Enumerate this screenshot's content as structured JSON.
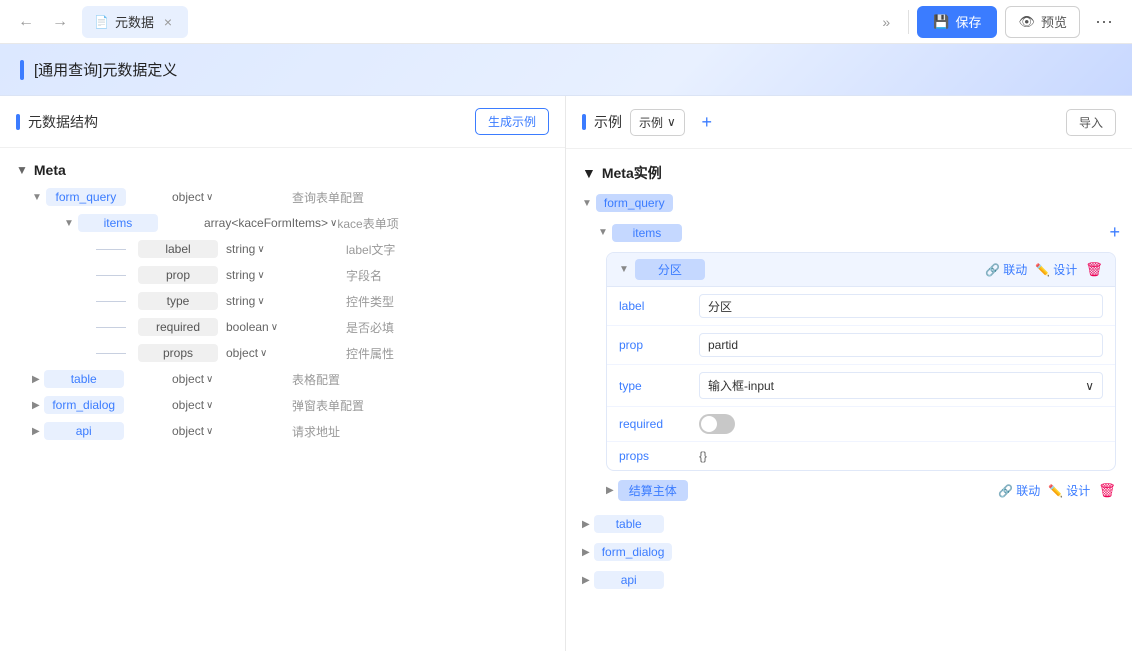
{
  "topbar": {
    "undo_label": "↩",
    "redo_label": "↪",
    "tab_label": "元数据",
    "tab_icon": "📄",
    "expand_icon": "»",
    "save_label": "保存",
    "save_icon": "💾",
    "preview_label": "预览",
    "preview_icon": "👁",
    "more_icon": "•••"
  },
  "page_title": "[通用查询]元数据定义",
  "left_panel": {
    "title": "元数据结构",
    "gen_btn": "生成示例",
    "section": "Meta",
    "items": [
      {
        "key": "form_query",
        "type": "object",
        "desc": "查询表单配置",
        "level": 1,
        "expanded": true,
        "children": [
          {
            "key": "items",
            "type": "array<kaceFormItems>",
            "desc": "kace表单项",
            "level": 2,
            "expanded": true,
            "children": [
              {
                "key": "label",
                "type": "string",
                "desc": "label文字",
                "level": 3
              },
              {
                "key": "prop",
                "type": "string",
                "desc": "字段名",
                "level": 3
              },
              {
                "key": "type",
                "type": "string",
                "desc": "控件类型",
                "level": 3
              },
              {
                "key": "required",
                "type": "boolean",
                "desc": "是否必填",
                "level": 3
              },
              {
                "key": "props",
                "type": "object",
                "desc": "控件属性",
                "level": 3
              }
            ]
          }
        ]
      },
      {
        "key": "table",
        "type": "object",
        "desc": "表格配置",
        "level": 1,
        "expanded": false
      },
      {
        "key": "form_dialog",
        "type": "object",
        "desc": "弹窗表单配置",
        "level": 1,
        "expanded": false
      },
      {
        "key": "api",
        "type": "object",
        "desc": "请求地址",
        "level": 1,
        "expanded": false
      }
    ]
  },
  "right_panel": {
    "title": "示例",
    "section": "Meta实例",
    "example_label": "示例",
    "import_label": "导入",
    "add_icon": "+",
    "items": [
      {
        "key": "form_query",
        "level": 1,
        "expanded": true,
        "selected": true
      },
      {
        "key": "items",
        "level": 2,
        "expanded": true,
        "selected": true,
        "children": [
          {
            "key": "分区",
            "level": 3,
            "expanded": true,
            "selected": true,
            "fields": [
              {
                "label": "label",
                "value": "分区",
                "type": "input"
              },
              {
                "label": "prop",
                "value": "partid",
                "type": "input"
              },
              {
                "label": "type",
                "value": "输入框-input",
                "type": "select"
              },
              {
                "label": "required",
                "value": "",
                "type": "toggle"
              },
              {
                "label": "props",
                "value": "{}",
                "type": "text"
              }
            ],
            "children": [
              {
                "key": "结算主体",
                "level": 4,
                "expanded": false
              }
            ]
          }
        ]
      },
      {
        "key": "table",
        "level": 1,
        "expanded": false
      },
      {
        "key": "form_dialog",
        "level": 1,
        "expanded": false
      },
      {
        "key": "api",
        "level": 1,
        "expanded": false
      }
    ]
  },
  "actions": {
    "link_label": "联动",
    "design_label": "设计",
    "delete_icon": "🗑"
  }
}
